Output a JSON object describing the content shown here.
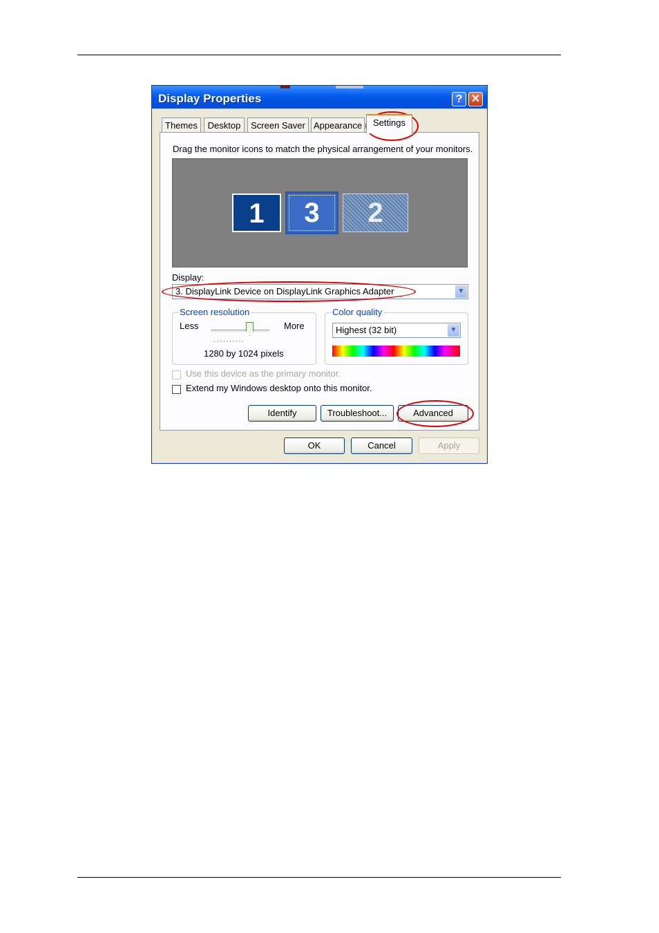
{
  "dialog": {
    "title": "Display Properties",
    "help_glyph": "?",
    "close_glyph": "✕"
  },
  "tabs": [
    {
      "label": "Themes"
    },
    {
      "label": "Desktop"
    },
    {
      "label": "Screen Saver"
    },
    {
      "label": "Appearance"
    },
    {
      "label": "Settings",
      "active": true
    }
  ],
  "settings": {
    "instruction": "Drag the monitor icons to match the physical arrangement of your monitors.",
    "monitors": [
      {
        "number": "1"
      },
      {
        "number": "3",
        "selected": true
      },
      {
        "number": "2"
      }
    ],
    "display_label": "Display:",
    "display_value": "3. DisplayLink Device on DisplayLink Graphics Adapter",
    "screen_resolution": {
      "title": "Screen resolution",
      "less_label": "Less",
      "more_label": "More",
      "value_text": "1280 by 1024 pixels"
    },
    "color_quality": {
      "title": "Color quality",
      "value": "Highest (32 bit)"
    },
    "primary_checkbox_label": "Use this device as the primary monitor.",
    "extend_checkbox_label": "Extend my Windows desktop onto this monitor.",
    "identify_label": "Identify",
    "troubleshoot_label": "Troubleshoot...",
    "advanced_label": "Advanced"
  },
  "footer": {
    "ok_label": "OK",
    "cancel_label": "Cancel",
    "apply_label": "Apply"
  },
  "colors": {
    "titlebar": "#0055e5",
    "annotation": "#e00000"
  }
}
